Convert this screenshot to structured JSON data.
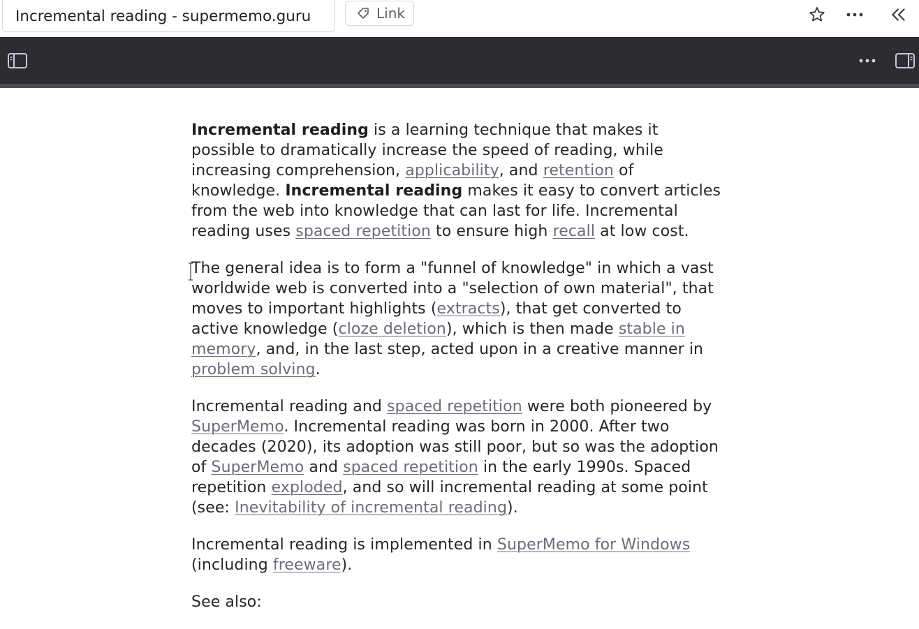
{
  "titlebar": {
    "title": "Incremental reading - supermemo.guru",
    "link_chip_label": "Link",
    "icons": [
      "tag-icon",
      "star-icon",
      "more-icon",
      "collapse-left-icon"
    ]
  },
  "toolbar": {
    "icons": [
      "sidebar-left-icon",
      "more-icon",
      "sidebar-right-icon"
    ]
  },
  "article": {
    "p1": {
      "s1": "Incremental reading",
      "t1": " is a learning technique that makes it possible to dramatically increase the speed of reading, while increasing comprehension, ",
      "l1": "applicability",
      "t2": ", and ",
      "l2": "retention",
      "t3": " of knowledge. ",
      "s2": "Incremental reading",
      "t4": " makes it easy to convert articles from the web into knowledge that can last for life. Incremental reading uses ",
      "l3": "spaced repetition",
      "t5": " to ensure high ",
      "l4": "recall",
      "t6": " at low cost."
    },
    "p2": {
      "t1": "The general idea is to form a \"funnel of knowledge\" in which a vast worldwide web is converted into a \"selection of own material\", that moves to important highlights (",
      "l1": "extracts",
      "t2": "), that get converted to active knowledge (",
      "l2": "cloze deletion",
      "t3": "), which is then made ",
      "l3": "stable in memory",
      "t4": ", and, in the last step, acted upon in a creative manner in ",
      "l4": "problem solving",
      "t5": "."
    },
    "p3": {
      "t1": "Incremental reading and ",
      "l1": "spaced repetition",
      "t2": " were both pioneered by ",
      "l2": "SuperMemo",
      "t3": ". Incremental reading was born in 2000. After two decades (2020), its adoption was still poor, but so was the adoption of ",
      "l3": "SuperMemo",
      "t4": " and ",
      "l4": "spaced repetition",
      "t5": " in the early 1990s. Spaced repetition ",
      "l5": "exploded",
      "t6": ", and so will incremental reading at some point (see: ",
      "l6": "Inevitability of incremental reading",
      "t7": ")."
    },
    "p4": {
      "t1": "Incremental reading is implemented in ",
      "l1": "SuperMemo for Windows",
      "t2": " (including ",
      "l2": "freeware",
      "t3": ")."
    },
    "p5": {
      "t1": "See also:"
    }
  },
  "colors": {
    "toolbar_bg": "#2c2c33",
    "link": "#6b6b7d",
    "text": "#26262b"
  }
}
